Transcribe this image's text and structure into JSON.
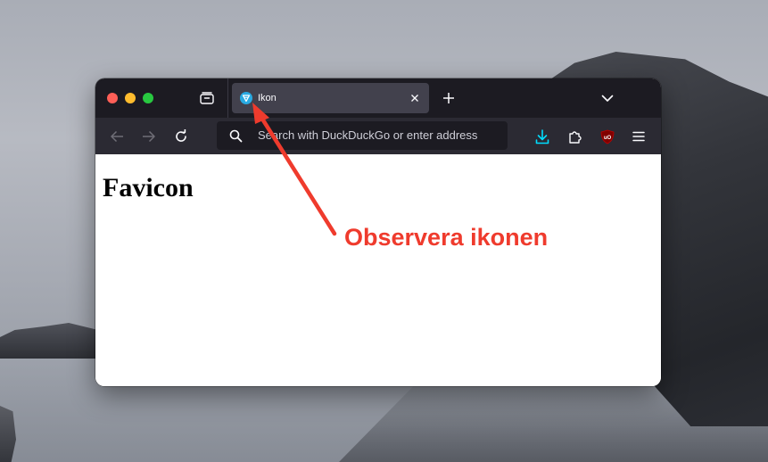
{
  "browser": {
    "tab": {
      "title": "Ikon",
      "favicon_color": "#29aae1"
    },
    "address_bar": {
      "placeholder": "Search with DuckDuckGo or enter address"
    },
    "icons": {
      "tab_overview": "tab-overview-icon",
      "close_tab": "close-icon",
      "new_tab": "plus-icon",
      "list_tabs": "chevron-down-icon",
      "back": "arrow-left-icon",
      "forward": "arrow-right-icon",
      "reload": "reload-icon",
      "search": "search-icon",
      "downloads": "download-icon",
      "extensions": "puzzle-icon",
      "ublock": "ublock-origin-icon",
      "menu": "hamburger-menu-icon"
    },
    "colors": {
      "tab_bar": "#1c1b22",
      "nav_bar": "#2b2a33",
      "active_tab": "#42414d",
      "download_accent": "#00ddff",
      "ublock_red": "#800000"
    }
  },
  "page": {
    "heading": "Favicon"
  },
  "annotation": {
    "text": "Observera ikonen",
    "color": "#ef3b2d"
  }
}
